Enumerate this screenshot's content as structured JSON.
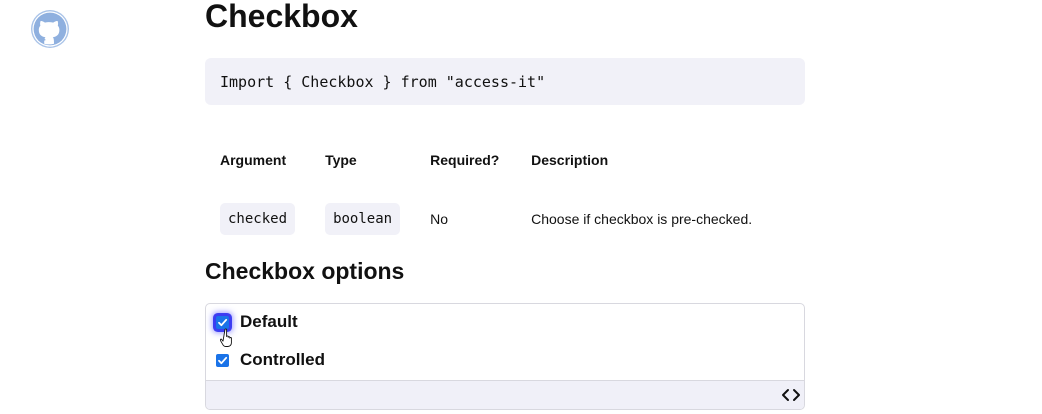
{
  "header": {
    "github_icon": "github-icon"
  },
  "page": {
    "title": "Checkbox",
    "import_statement": "Import { Checkbox } from \"access-it\""
  },
  "props_table": {
    "columns": [
      "Argument",
      "Type",
      "Required?",
      "Description"
    ],
    "rows": [
      {
        "argument": "checked",
        "type": "boolean",
        "required": "No",
        "description": "Choose if checkbox is pre-checked."
      }
    ]
  },
  "options": {
    "title": "Checkbox options",
    "items": [
      {
        "label": "Default",
        "checked": true,
        "focused": true
      },
      {
        "label": "Controlled",
        "checked": true,
        "focused": false
      }
    ],
    "code_toggle_icon": "code-brackets-icon"
  },
  "colors": {
    "accent": "#1a73e8",
    "code_background": "#f1f1f8",
    "focus_ring": "#2828f0",
    "github_icon": "#9cb8e0"
  }
}
